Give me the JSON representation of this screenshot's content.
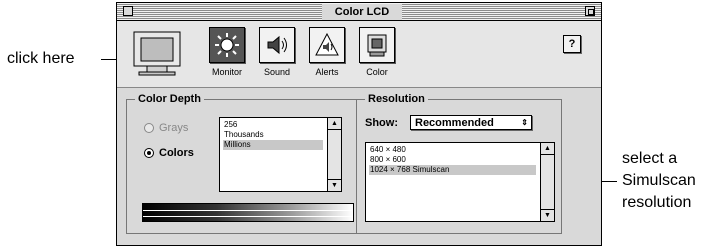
{
  "callouts": {
    "left": "click here",
    "right": [
      "select a",
      "Simulscan",
      "resolution"
    ]
  },
  "window": {
    "title": "Color LCD"
  },
  "toolbar": {
    "items": [
      {
        "label": "Monitor",
        "icon": "sun-icon",
        "selected": true
      },
      {
        "label": "Sound",
        "icon": "speaker-icon",
        "selected": false
      },
      {
        "label": "Alerts",
        "icon": "alert-icon",
        "selected": false
      },
      {
        "label": "Color",
        "icon": "color-icon",
        "selected": false
      }
    ],
    "help_label": "?"
  },
  "color_depth": {
    "title": "Color Depth",
    "radios": [
      {
        "label": "Grays",
        "state": "disabled"
      },
      {
        "label": "Colors",
        "state": "checked"
      }
    ],
    "list": [
      "256",
      "Thousands",
      "Millions"
    ],
    "selected_index": 2
  },
  "resolution": {
    "title": "Resolution",
    "show_label": "Show:",
    "show_value": "Recommended",
    "list": [
      "640 × 480",
      "800 × 600",
      "1024 × 768  Simulscan"
    ],
    "selected_index": 2
  }
}
